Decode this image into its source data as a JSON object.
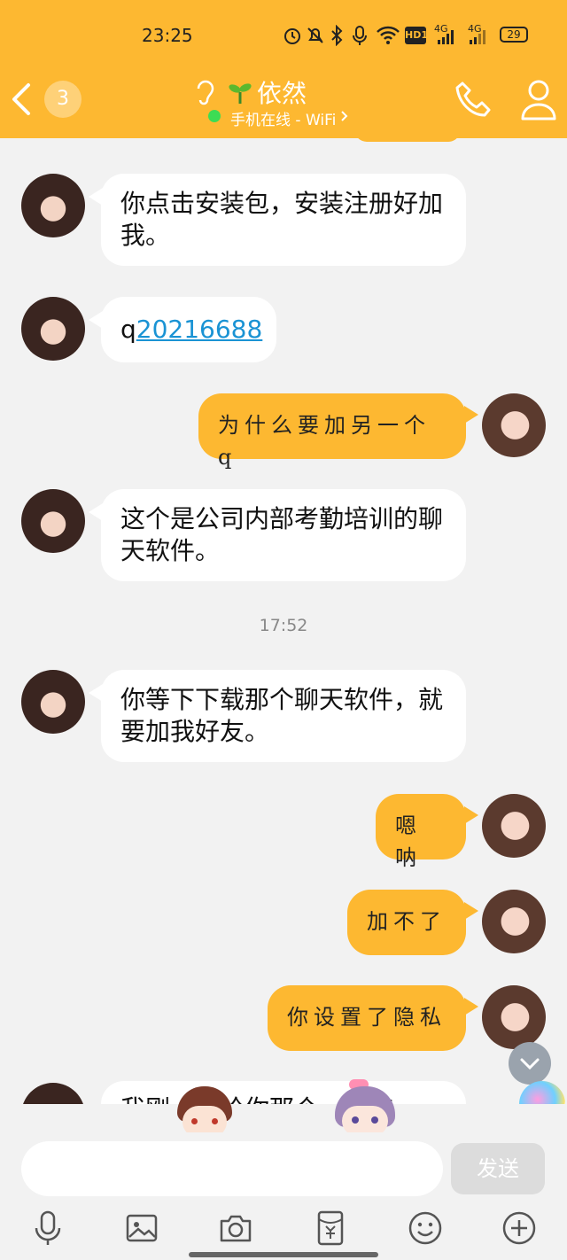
{
  "status_bar": {
    "time": "23:25",
    "battery": "29",
    "network_1": "4G",
    "network_2": "4G",
    "hd_label": "HD1"
  },
  "header": {
    "unread_count": "3",
    "contact_name": "依然",
    "online_status": "手机在线 - WiFi"
  },
  "messages": [
    {
      "side": "left",
      "text": "你点击安装包，安装注册好加我。"
    },
    {
      "side": "left",
      "text_prefix": "q",
      "link": "20216688"
    },
    {
      "side": "right",
      "text": "为什么要加另一个q"
    },
    {
      "side": "left",
      "text": "这个是公司内部考勤培训的聊天软件。"
    },
    {
      "side": "left",
      "text": "你等下下载那个聊天软件，就要加我好友。"
    },
    {
      "side": "right",
      "text": "嗯呐"
    },
    {
      "side": "right",
      "text": "加不了"
    },
    {
      "side": "right",
      "text": "你设置了隐私"
    },
    {
      "side": "left",
      "text": "我刚……给你那个……有"
    }
  ],
  "timestamp": "17:52",
  "input": {
    "value": "",
    "placeholder": ""
  },
  "send_label": "发送",
  "toolbar": [
    "mic-icon",
    "image-icon",
    "camera-icon",
    "red-packet-icon",
    "emoji-icon",
    "plus-icon"
  ],
  "colors": {
    "header": "#fdb831",
    "bubble_out": "#fdb831",
    "link": "#1a93d4"
  }
}
